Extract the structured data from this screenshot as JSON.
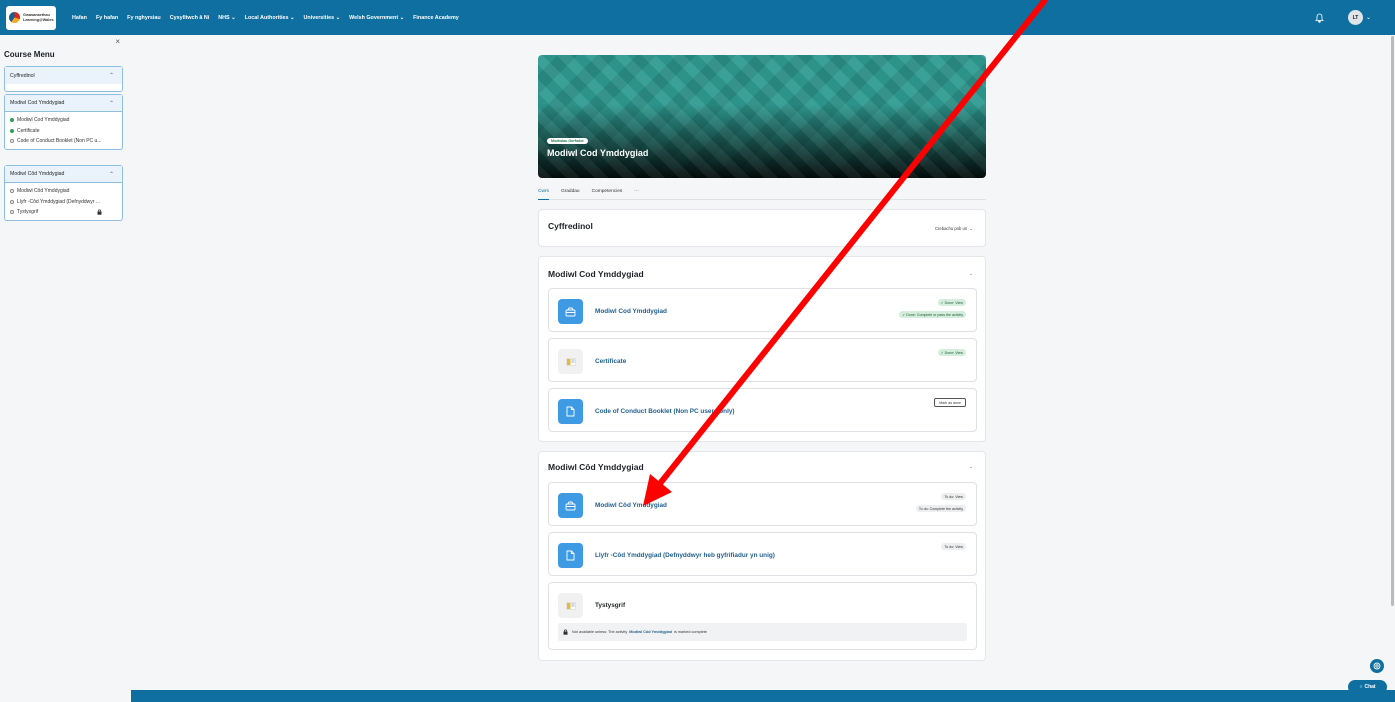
{
  "brand": {
    "logo_line1": "Gwasanaethau",
    "logo_line2": "Learning@Wales"
  },
  "navbar": {
    "links": [
      "Hafan",
      "Fy hafan",
      "Fy nghyrsiau",
      "Cysylltwch â Ni",
      "NHS ⌄",
      "Local Authorities ⌄",
      "Universities ⌄",
      "Welsh Government ⌄",
      "Finance Academy"
    ],
    "user_initials": "LT"
  },
  "drawer": {
    "close": "×",
    "title": "Course Menu",
    "sections": [
      {
        "label": "Cyffredinol",
        "items": []
      },
      {
        "label": "Modiwl Cod Ymddygiad",
        "items": [
          {
            "label": "Modiwl Cod Ymddygiad",
            "status": "done"
          },
          {
            "label": "Certificate",
            "status": "done"
          },
          {
            "label": "Code of Conduct Booklet (Non PC u...",
            "status": "todo"
          }
        ]
      },
      {
        "label": "Modiwl Côd Ymddygiad",
        "items": [
          {
            "label": "Modiwl Côd Ymddygiad",
            "status": "todo"
          },
          {
            "label": "Llyfr -Côd Ymddygiad (Defnyddwyr ...",
            "status": "todo"
          },
          {
            "label": "Tystysgrif",
            "status": "todo",
            "locked": true
          }
        ]
      }
    ]
  },
  "course": {
    "badge": "Modiwlau Gorfodol",
    "title": "Modiwl Cod Ymddygiad",
    "tabs": [
      "Cwrs",
      "Graddau",
      "Competencies",
      "···"
    ]
  },
  "sections": {
    "general": {
      "title": "Cyffredinol",
      "action": "Crebachu pob un"
    },
    "s1": {
      "title": "Modiwl Cod Ymddygiad",
      "activities": [
        {
          "name": "Modiwl Cod Ymddygiad",
          "pill1": "✓ Done: View",
          "pill2": "✓ Done: Complete or pass the activity"
        },
        {
          "name": "Certificate",
          "pill1": "✓ Done: View"
        },
        {
          "name": "Code of Conduct Booklet (Non PC users only)",
          "button": "Mark as done"
        }
      ]
    },
    "s2": {
      "title": "Modiwl Côd Ymddygiad",
      "activities": [
        {
          "name": "Modiwl Côd Ymddygiad",
          "pill1": "To do: View",
          "pill2": "To do: Complete the activity"
        },
        {
          "name": "Llyfr -Côd Ymddygiad (Defnyddwyr heb gyfrifiadur yn unig)",
          "pill1": "To do: View"
        },
        {
          "name": "Tystysgrif",
          "restriction_pre": "Not available unless: The activity",
          "restriction_link": "Modiwl Côd Ymddygiad",
          "restriction_post": "is marked complete"
        }
      ]
    }
  },
  "chat": {
    "label": "Chat"
  },
  "colors": {
    "navbar": "#0f6fa0",
    "accent": "#3d9ae3",
    "annotation_arrow": "#ff0000"
  }
}
